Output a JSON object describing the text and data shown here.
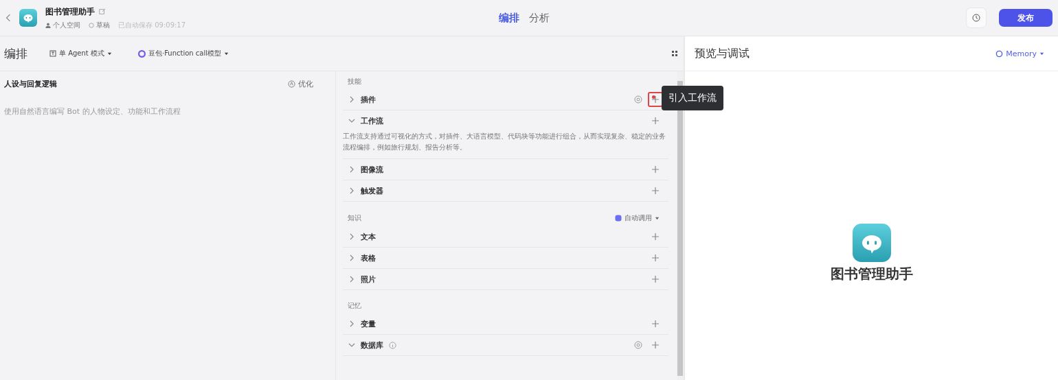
{
  "header": {
    "title": "图书管理助手",
    "space": "个人空间",
    "status": "草稿",
    "saved": "已自动保存 09:09:17",
    "tabs": [
      {
        "label": "编排",
        "selected": true
      },
      {
        "label": "分析",
        "selected": false
      }
    ],
    "publish": "发布"
  },
  "toolbar": {
    "title": "编排",
    "mode": "单 Agent 模式",
    "model": "豆包·Function call模型"
  },
  "persona": {
    "title": "人设与回复逻辑",
    "optimize": "优化",
    "placeholder": "使用自然语言编写 Bot 的人物设定、功能和工作流程"
  },
  "sections": [
    {
      "title": "技能",
      "items": [
        {
          "label": "插件",
          "expanded": false,
          "extra_icon": true,
          "highlighted": true,
          "tooltip": "引入工作流"
        },
        {
          "label": "工作流",
          "expanded": true,
          "extra_icon": false,
          "highlighted": false,
          "description": "工作流支持通过可视化的方式，对插件、大语言模型、代码块等功能进行组合，从而实现复杂、稳定的业务流程编排，例如旅行规划、报告分析等。"
        },
        {
          "label": "图像流",
          "expanded": false,
          "extra_icon": false,
          "highlighted": false
        },
        {
          "label": "触发器",
          "expanded": false,
          "extra_icon": false,
          "highlighted": false
        }
      ]
    },
    {
      "title": "知识",
      "action": "自动调用",
      "items": [
        {
          "label": "文本",
          "expanded": false,
          "extra_icon": false,
          "highlighted": false
        },
        {
          "label": "表格",
          "expanded": false,
          "extra_icon": false,
          "highlighted": false
        },
        {
          "label": "照片",
          "expanded": false,
          "extra_icon": false,
          "highlighted": false
        }
      ]
    },
    {
      "title": "记忆",
      "items": [
        {
          "label": "变量",
          "expanded": false,
          "extra_icon": false,
          "highlighted": false
        },
        {
          "label": "数据库",
          "expanded": true,
          "extra_icon": true,
          "info": true,
          "highlighted": false
        }
      ]
    }
  ],
  "preview": {
    "title": "预览与调试",
    "memory": "Memory",
    "bot_name": "图书管理助手"
  }
}
